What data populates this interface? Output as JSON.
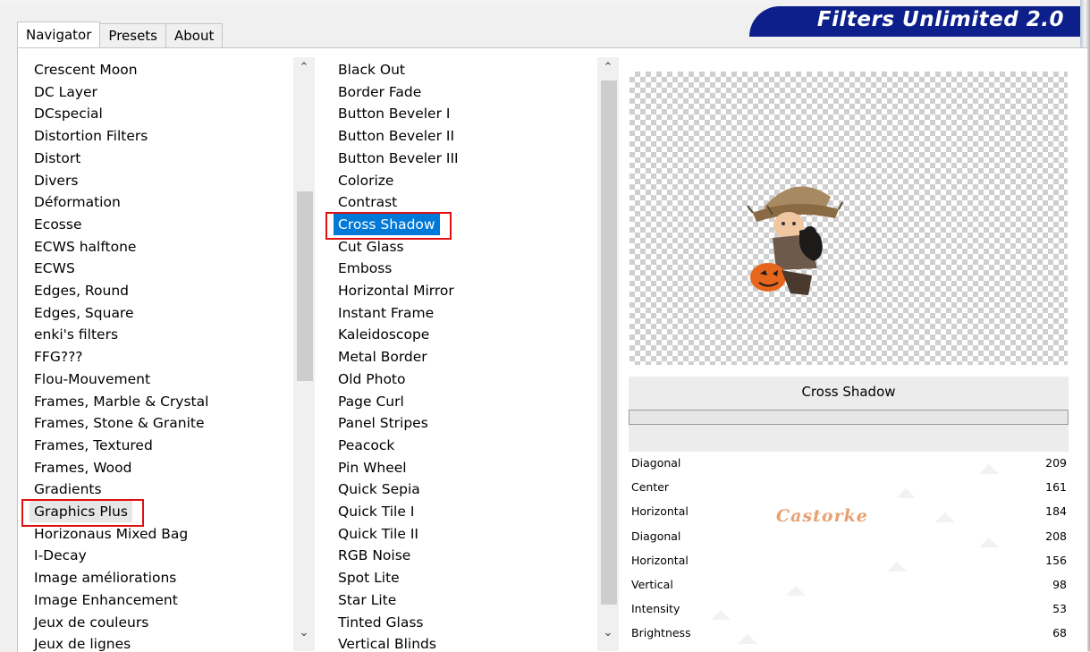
{
  "app": {
    "banner_title": "Filters Unlimited 2.0"
  },
  "tabs": [
    {
      "label": "Navigator",
      "active": true
    },
    {
      "label": "Presets",
      "active": false
    },
    {
      "label": "About",
      "active": false
    }
  ],
  "categories": {
    "items": [
      "Crescent Moon",
      "DC Layer",
      "DCspecial",
      "Distortion Filters",
      "Distort",
      "Divers",
      "Déformation",
      "Ecosse",
      "ECWS halftone",
      "ECWS",
      "Edges, Round",
      "Edges, Square",
      "enki's filters",
      "FFG???",
      "Flou-Mouvement",
      "Frames, Marble & Crystal",
      "Frames, Stone & Granite",
      "Frames, Textured",
      "Frames, Wood",
      "Gradients",
      "Graphics Plus",
      "Horizonaus Mixed Bag",
      "I-Decay",
      "Image améliorations",
      "Image Enhancement",
      "Jeux de couleurs",
      "Jeux de lignes"
    ],
    "selected": "Graphics Plus"
  },
  "filters": {
    "items": [
      "Black Out",
      "Border Fade",
      "Button Beveler I",
      "Button Beveler II",
      "Button Beveler III",
      "Colorize",
      "Contrast",
      "Cross Shadow",
      "Cut Glass",
      "Emboss",
      "Horizontal Mirror",
      "Instant Frame",
      "Kaleidoscope",
      "Metal Border",
      "Old Photo",
      "Page Curl",
      "Panel Stripes",
      "Peacock",
      "Pin Wheel",
      "Quick Sepia",
      "Quick Tile I",
      "Quick Tile II",
      "RGB Noise",
      "Spot Lite",
      "Star Lite",
      "Tinted Glass",
      "Vertical Blinds"
    ],
    "selected": "Cross Shadow"
  },
  "preview": {
    "filter_name": "Cross Shadow",
    "watermark": "Castorke"
  },
  "parameters": [
    {
      "name": "Diagonal",
      "value": "209",
      "level": 0.82
    },
    {
      "name": "Center",
      "value": "161",
      "level": 0.63
    },
    {
      "name": "Horizontal",
      "value": "184",
      "level": 0.72
    },
    {
      "name": "Diagonal",
      "value": "208",
      "level": 0.82
    },
    {
      "name": "Horizontal",
      "value": "156",
      "level": 0.61
    },
    {
      "name": "Vertical",
      "value": "98",
      "level": 0.38
    },
    {
      "name": "Intensity",
      "value": "53",
      "level": 0.21
    },
    {
      "name": "Brightness",
      "value": "68",
      "level": 0.27
    }
  ],
  "colors": {
    "selection_blue": "#0078d7",
    "highlight_red": "#e01010",
    "banner_navy": "#0d1f8a"
  },
  "icons": {
    "scroll_up": "chevron-up-icon",
    "scroll_down": "chevron-down-icon"
  }
}
